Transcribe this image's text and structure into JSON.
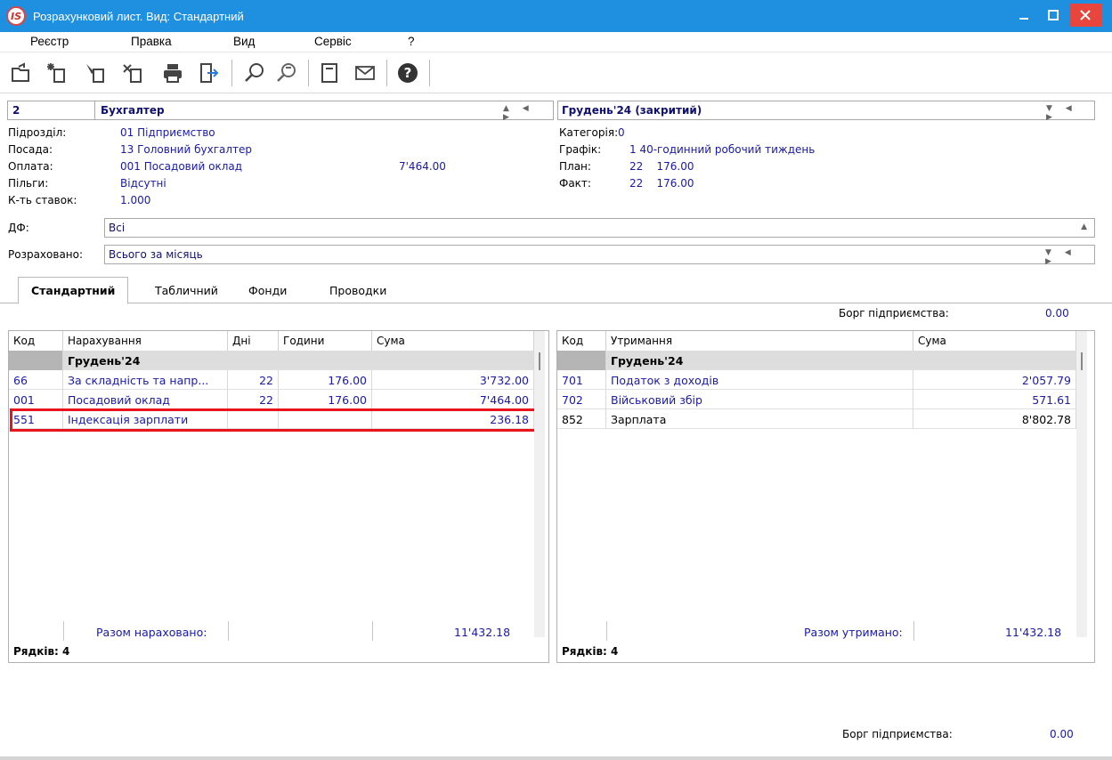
{
  "window": {
    "logo": "IS",
    "title": "Розрахунковий лист. Вид: Стандартний",
    "minimize_icon": "minimize-icon",
    "maximize_icon": "maximize-icon",
    "close_icon": "close-icon"
  },
  "menu": [
    "Реєстр",
    "Правка",
    "Вид",
    "Сервіс",
    "?"
  ],
  "toolbar_icons": [
    "open-folder-icon",
    "create-icon",
    "edit-icon",
    "copy-icon",
    "print-icon",
    "exit-icon",
    "search-icon",
    "filter-icon",
    "document-icon",
    "email-icon",
    "help-icon"
  ],
  "employee": {
    "number": "2",
    "name": "Бухгалтер",
    "period": "Грудень'24 (закритий)"
  },
  "details_left": [
    {
      "label": "Підрозділ:",
      "value": "01  Підприємство"
    },
    {
      "label": "Посада:",
      "value": "13  Головний бухгалтер"
    },
    {
      "label": "Оплата:",
      "value": "001 Посадовий оклад",
      "amount": "7'464.00"
    },
    {
      "label": "Пільги:",
      "value": "Відсутні"
    },
    {
      "label": "К-ть ставок:",
      "value": "1.000"
    }
  ],
  "details_right": [
    {
      "label": "Категорія:",
      "value": "0"
    },
    {
      "label": "Графік:",
      "value": "1  40-годинний робочий тиждень"
    },
    {
      "label": "План:",
      "value": "22    176.00"
    },
    {
      "label": "Факт:",
      "value": "22    176.00"
    }
  ],
  "df": {
    "label": "ДФ:",
    "value": "Всі"
  },
  "calculated": {
    "label": "Розраховано:",
    "value": "Всього за місяць"
  },
  "tabs": [
    "Стандартний",
    "Табличний",
    "Фонди",
    "Проводки"
  ],
  "debt_top": {
    "label": "Борг підприємства:",
    "value": "0.00"
  },
  "accruals": {
    "columns": [
      "Код",
      "Нарахування",
      "Дні",
      "Години",
      "Сума"
    ],
    "group": "Грудень'24",
    "rows": [
      {
        "code": "66",
        "name": "За складність та напр...",
        "days": "22",
        "hours": "176.00",
        "sum": "3'732.00"
      },
      {
        "code": "001",
        "name": "Посадовий оклад",
        "days": "22",
        "hours": "176.00",
        "sum": "7'464.00"
      },
      {
        "code": "551",
        "name": "Індексація зарплати",
        "days": "",
        "hours": "",
        "sum": "236.18"
      }
    ],
    "total_label": "Разом нараховано:",
    "total": "11'432.18",
    "rows_count": "Рядків: 4"
  },
  "deductions": {
    "columns": [
      "Код",
      "Утримання",
      "Сума"
    ],
    "group": "Грудень'24",
    "rows": [
      {
        "code": "701",
        "name": "Податок з доходів",
        "sum": "2'057.79"
      },
      {
        "code": "702",
        "name": "Військовий збір",
        "sum": "571.61"
      },
      {
        "code": "852",
        "name": "Зарплата",
        "sum": "8'802.78"
      }
    ],
    "total_label": "Разом утримано:",
    "total": "11'432.18",
    "rows_count": "Рядків: 4"
  },
  "debt_bottom": {
    "label": "Борг підприємства:",
    "value": "0.00"
  },
  "highlight_color": "#e8131b"
}
